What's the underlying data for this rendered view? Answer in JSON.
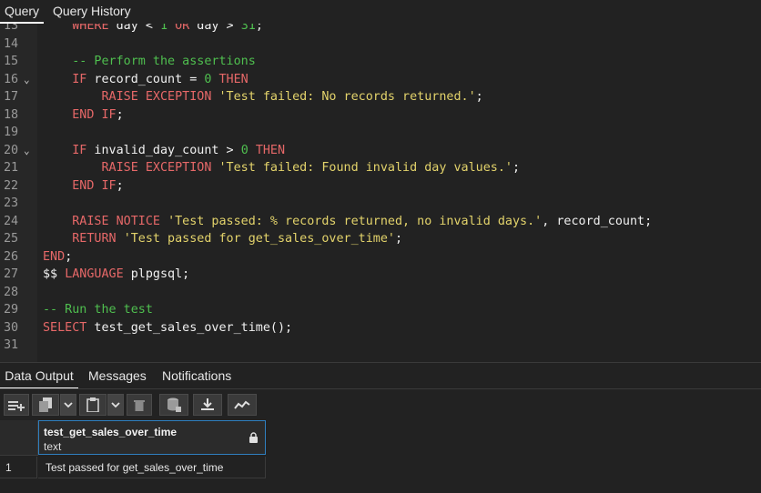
{
  "tabs": {
    "query": "Query",
    "history": "Query History"
  },
  "editor": {
    "lines": [
      {
        "n": "13",
        "fold": "",
        "tokens": [
          {
            "t": "    ",
            "c": "pl"
          },
          {
            "t": "WHERE",
            "c": "kw"
          },
          {
            "t": " day < ",
            "c": "pl"
          },
          {
            "t": "1",
            "c": "num"
          },
          {
            "t": " ",
            "c": "pl"
          },
          {
            "t": "OR",
            "c": "kw"
          },
          {
            "t": " day > ",
            "c": "pl"
          },
          {
            "t": "31",
            "c": "num"
          },
          {
            "t": ";",
            "c": "pl"
          }
        ]
      },
      {
        "n": "14",
        "fold": "",
        "tokens": []
      },
      {
        "n": "15",
        "fold": "",
        "tokens": [
          {
            "t": "    -- Perform the assertions",
            "c": "cmt"
          }
        ]
      },
      {
        "n": "16",
        "fold": "⌄",
        "tokens": [
          {
            "t": "    ",
            "c": "pl"
          },
          {
            "t": "IF",
            "c": "kw"
          },
          {
            "t": " record_count = ",
            "c": "pl"
          },
          {
            "t": "0",
            "c": "num"
          },
          {
            "t": " ",
            "c": "pl"
          },
          {
            "t": "THEN",
            "c": "kw"
          }
        ]
      },
      {
        "n": "17",
        "fold": "",
        "tokens": [
          {
            "t": "        ",
            "c": "pl"
          },
          {
            "t": "RAISE EXCEPTION",
            "c": "kw"
          },
          {
            "t": " ",
            "c": "pl"
          },
          {
            "t": "'Test failed: No records returned.'",
            "c": "str"
          },
          {
            "t": ";",
            "c": "pl"
          }
        ]
      },
      {
        "n": "18",
        "fold": "",
        "tokens": [
          {
            "t": "    ",
            "c": "pl"
          },
          {
            "t": "END IF",
            "c": "kw"
          },
          {
            "t": ";",
            "c": "pl"
          }
        ]
      },
      {
        "n": "19",
        "fold": "",
        "tokens": []
      },
      {
        "n": "20",
        "fold": "⌄",
        "tokens": [
          {
            "t": "    ",
            "c": "pl"
          },
          {
            "t": "IF",
            "c": "kw"
          },
          {
            "t": " invalid_day_count > ",
            "c": "pl"
          },
          {
            "t": "0",
            "c": "num"
          },
          {
            "t": " ",
            "c": "pl"
          },
          {
            "t": "THEN",
            "c": "kw"
          }
        ]
      },
      {
        "n": "21",
        "fold": "",
        "tokens": [
          {
            "t": "        ",
            "c": "pl"
          },
          {
            "t": "RAISE EXCEPTION",
            "c": "kw"
          },
          {
            "t": " ",
            "c": "pl"
          },
          {
            "t": "'Test failed: Found invalid day values.'",
            "c": "str"
          },
          {
            "t": ";",
            "c": "pl"
          }
        ]
      },
      {
        "n": "22",
        "fold": "",
        "tokens": [
          {
            "t": "    ",
            "c": "pl"
          },
          {
            "t": "END IF",
            "c": "kw"
          },
          {
            "t": ";",
            "c": "pl"
          }
        ]
      },
      {
        "n": "23",
        "fold": "",
        "tokens": []
      },
      {
        "n": "24",
        "fold": "",
        "tokens": [
          {
            "t": "    ",
            "c": "pl"
          },
          {
            "t": "RAISE NOTICE",
            "c": "kw"
          },
          {
            "t": " ",
            "c": "pl"
          },
          {
            "t": "'Test passed: % records returned, no invalid days.'",
            "c": "str"
          },
          {
            "t": ", record_count;",
            "c": "pl"
          }
        ]
      },
      {
        "n": "25",
        "fold": "",
        "tokens": [
          {
            "t": "    ",
            "c": "pl"
          },
          {
            "t": "RETURN",
            "c": "kw"
          },
          {
            "t": " ",
            "c": "pl"
          },
          {
            "t": "'Test passed for get_sales_over_time'",
            "c": "str"
          },
          {
            "t": ";",
            "c": "pl"
          }
        ]
      },
      {
        "n": "26",
        "fold": "",
        "tokens": [
          {
            "t": "END",
            "c": "kw"
          },
          {
            "t": ";",
            "c": "pl"
          }
        ]
      },
      {
        "n": "27",
        "fold": "",
        "tokens": [
          {
            "t": "$$ ",
            "c": "pl"
          },
          {
            "t": "LANGUAGE",
            "c": "kw"
          },
          {
            "t": " plpgsql;",
            "c": "pl"
          }
        ]
      },
      {
        "n": "28",
        "fold": "",
        "tokens": []
      },
      {
        "n": "29",
        "fold": "",
        "tokens": [
          {
            "t": "-- Run the test",
            "c": "cmt"
          }
        ]
      },
      {
        "n": "30",
        "fold": "",
        "tokens": [
          {
            "t": "SELECT",
            "c": "kw"
          },
          {
            "t": " test_get_sales_over_time();",
            "c": "pl"
          }
        ]
      },
      {
        "n": "31",
        "fold": "",
        "tokens": []
      }
    ]
  },
  "bottom_tabs": {
    "data_output": "Data Output",
    "messages": "Messages",
    "notifications": "Notifications"
  },
  "toolbar": {
    "buttons": [
      "add-row-icon",
      "copy-icon",
      "dropdown-icon",
      "paste-icon",
      "dropdown-icon",
      "delete-icon",
      "save-data-icon",
      "download-icon",
      "graph-icon"
    ]
  },
  "grid": {
    "column_name": "test_get_sales_over_time",
    "column_type": "text",
    "rows": [
      {
        "num": "1",
        "value": "Test passed for get_sales_over_time"
      }
    ]
  },
  "colors": {
    "keyword": "#e66868",
    "string": "#e3d36b",
    "comment": "#4fbf4f",
    "number": "#4fbf4f",
    "header_border": "#2f7fbf"
  }
}
